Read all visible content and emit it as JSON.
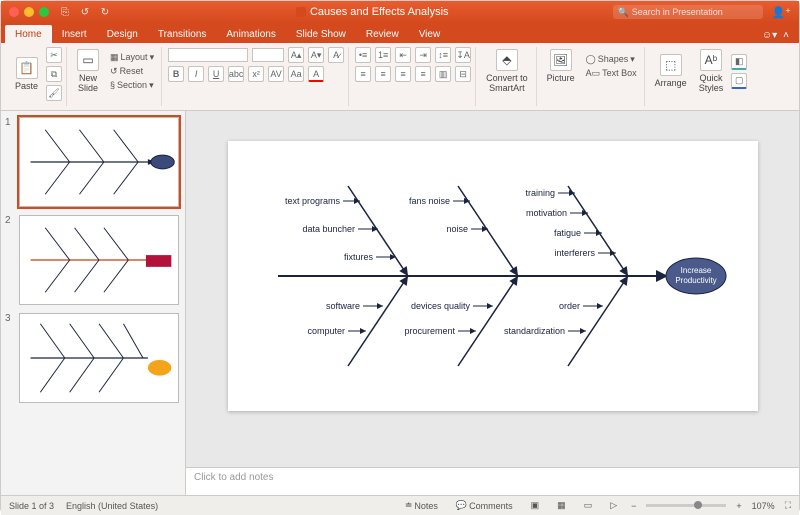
{
  "titlebar": {
    "title": "Causes and Effects Analysis",
    "search_placeholder": "Search in Presentation"
  },
  "tabs": {
    "home": "Home",
    "insert": "Insert",
    "design": "Design",
    "transitions": "Transitions",
    "animations": "Animations",
    "slideshow": "Slide Show",
    "review": "Review",
    "view": "View"
  },
  "ribbon": {
    "paste": "Paste",
    "new_slide": "New\nSlide",
    "layout": "Layout",
    "reset": "Reset",
    "section": "Section",
    "convert": "Convert to\nSmartArt",
    "picture": "Picture",
    "shapes": "Shapes",
    "textbox": "Text Box",
    "arrange": "Arrange",
    "quickstyles": "Quick\nStyles"
  },
  "thumbs": {
    "n1": "1",
    "n2": "2",
    "n3": "3"
  },
  "diagram": {
    "head": "Increase\nProductivity",
    "top1": [
      "text programs",
      "data buncher",
      "fixtures"
    ],
    "top2_a": "fans noise",
    "top2_b": "noise",
    "top3": [
      "training",
      "motivation",
      "fatigue",
      "interferers"
    ],
    "bot1": [
      "software",
      "computer"
    ],
    "bot2": [
      "devices quality",
      "procurement"
    ],
    "bot3": [
      "order",
      "standardization"
    ]
  },
  "notes": {
    "placeholder": "Click to add notes"
  },
  "status": {
    "slide": "Slide 1 of 3",
    "lang": "English (United States)",
    "notes": "Notes",
    "comments": "Comments",
    "zoom": "107%"
  }
}
